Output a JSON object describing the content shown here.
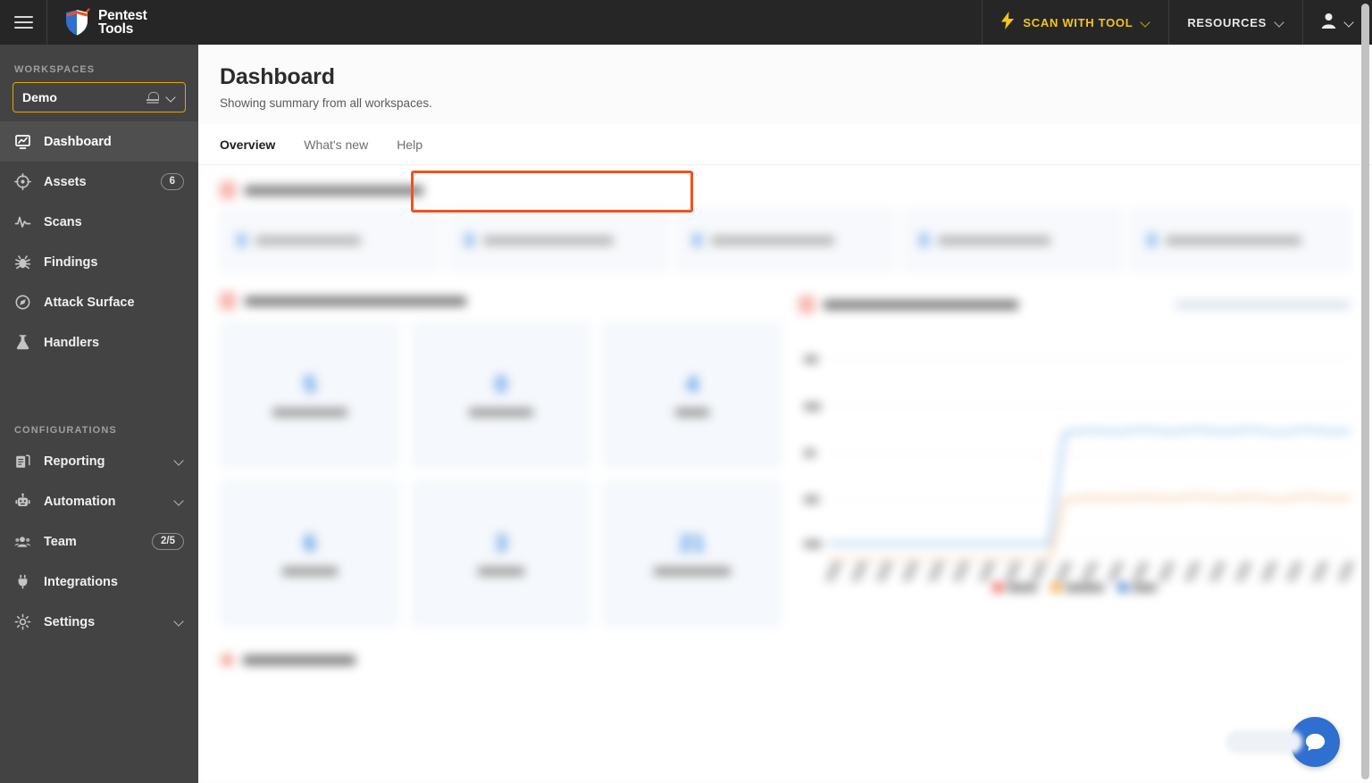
{
  "topbar": {
    "menu_icon": "hamburger-icon",
    "logo": {
      "line1": "Pentest",
      "line2": "Tools",
      "icon": "shield-logo-icon"
    },
    "scan_with_tool": {
      "label": "SCAN WITH TOOL",
      "icon": "lightning-bolt-icon",
      "chevron": "chevron-down-icon"
    },
    "resources": {
      "label": "RESOURCES",
      "chevron": "chevron-down-icon"
    },
    "account": {
      "icon": "user-avatar-icon",
      "chevron": "chevron-down-icon"
    }
  },
  "sidebar": {
    "workspaces_heading": "WORKSPACES",
    "workspace": {
      "name": "Demo",
      "bell_icon": "bell-icon",
      "chevron": "chevron-down-icon",
      "border_color": "#e0a800"
    },
    "nav": [
      {
        "label": "Dashboard",
        "icon": "dashboard-icon",
        "active": true
      },
      {
        "label": "Assets",
        "icon": "target-icon",
        "badge": "6"
      },
      {
        "label": "Scans",
        "icon": "pulse-icon"
      },
      {
        "label": "Findings",
        "icon": "bug-icon"
      },
      {
        "label": "Attack Surface",
        "icon": "compass-icon"
      },
      {
        "label": "Handlers",
        "icon": "flask-icon"
      }
    ],
    "configurations_heading": "CONFIGURATIONS",
    "config_nav": [
      {
        "label": "Reporting",
        "icon": "report-icon",
        "chevron": "chevron-down-icon"
      },
      {
        "label": "Automation",
        "icon": "robot-icon",
        "chevron": "chevron-down-icon"
      },
      {
        "label": "Team",
        "icon": "people-icon",
        "badge": "2/5"
      },
      {
        "label": "Integrations",
        "icon": "plug-icon"
      },
      {
        "label": "Settings",
        "icon": "gear-icon",
        "chevron": "chevron-down-icon"
      }
    ]
  },
  "page": {
    "title": "Dashboard",
    "subtitle": "Showing summary from all workspaces."
  },
  "tabs": [
    {
      "label": "Overview",
      "active": true
    },
    {
      "label": "What's new",
      "active": false
    },
    {
      "label": "Help",
      "active": false
    }
  ],
  "highlight": {
    "color": "#f4511e",
    "target": "tabs-row"
  },
  "content": {
    "redacted": true,
    "note": "Dashboard body content is blurred/redacted in the screenshot",
    "tile_value_visible": "21",
    "mini_cards_count": 5,
    "tiles_count": 6
  },
  "chart_data": {
    "type": "line",
    "title": "",
    "xlabel": "",
    "ylabel": "",
    "grid": true,
    "legend_position": "bottom",
    "x": [
      "t1",
      "t2",
      "t3",
      "t4",
      "t5",
      "t6",
      "t7",
      "t8",
      "t9",
      "t10",
      "t11",
      "t12",
      "t13",
      "t14",
      "t15",
      "t16",
      "t17",
      "t18",
      "t19",
      "t20",
      "t21"
    ],
    "series": [
      {
        "name": "",
        "color": "#ef4136",
        "values": [
          0,
          0,
          0,
          0,
          0,
          0,
          0,
          0,
          0,
          0,
          0,
          0,
          0,
          0,
          0,
          0,
          0,
          0,
          0,
          0,
          0
        ]
      },
      {
        "name": "",
        "color": "#f7941e",
        "values": [
          0,
          0,
          0,
          0,
          0,
          0,
          0,
          0,
          2.1,
          2.2,
          2.2,
          2.1,
          2.2,
          2.3,
          2.2,
          2.2,
          2.2,
          2.1,
          2.2,
          2.2,
          2.2
        ]
      },
      {
        "name": "",
        "color": "#2f6fd0",
        "values": [
          0.3,
          0.3,
          0.3,
          0.3,
          0.3,
          0.3,
          0.3,
          0.3,
          4.3,
          4.3,
          4.4,
          4.3,
          4.3,
          4.4,
          4.3,
          4.3,
          4.4,
          4.3,
          4.3,
          4.4,
          4.3
        ]
      }
    ],
    "ylim": [
      0,
      5
    ],
    "yticks": [
      5,
      4,
      3,
      2,
      0
    ]
  },
  "chat": {
    "icon": "chat-bubble-icon",
    "color": "#2f6fd0"
  },
  "scrollbar": {
    "orientation": "vertical",
    "position": "top"
  }
}
